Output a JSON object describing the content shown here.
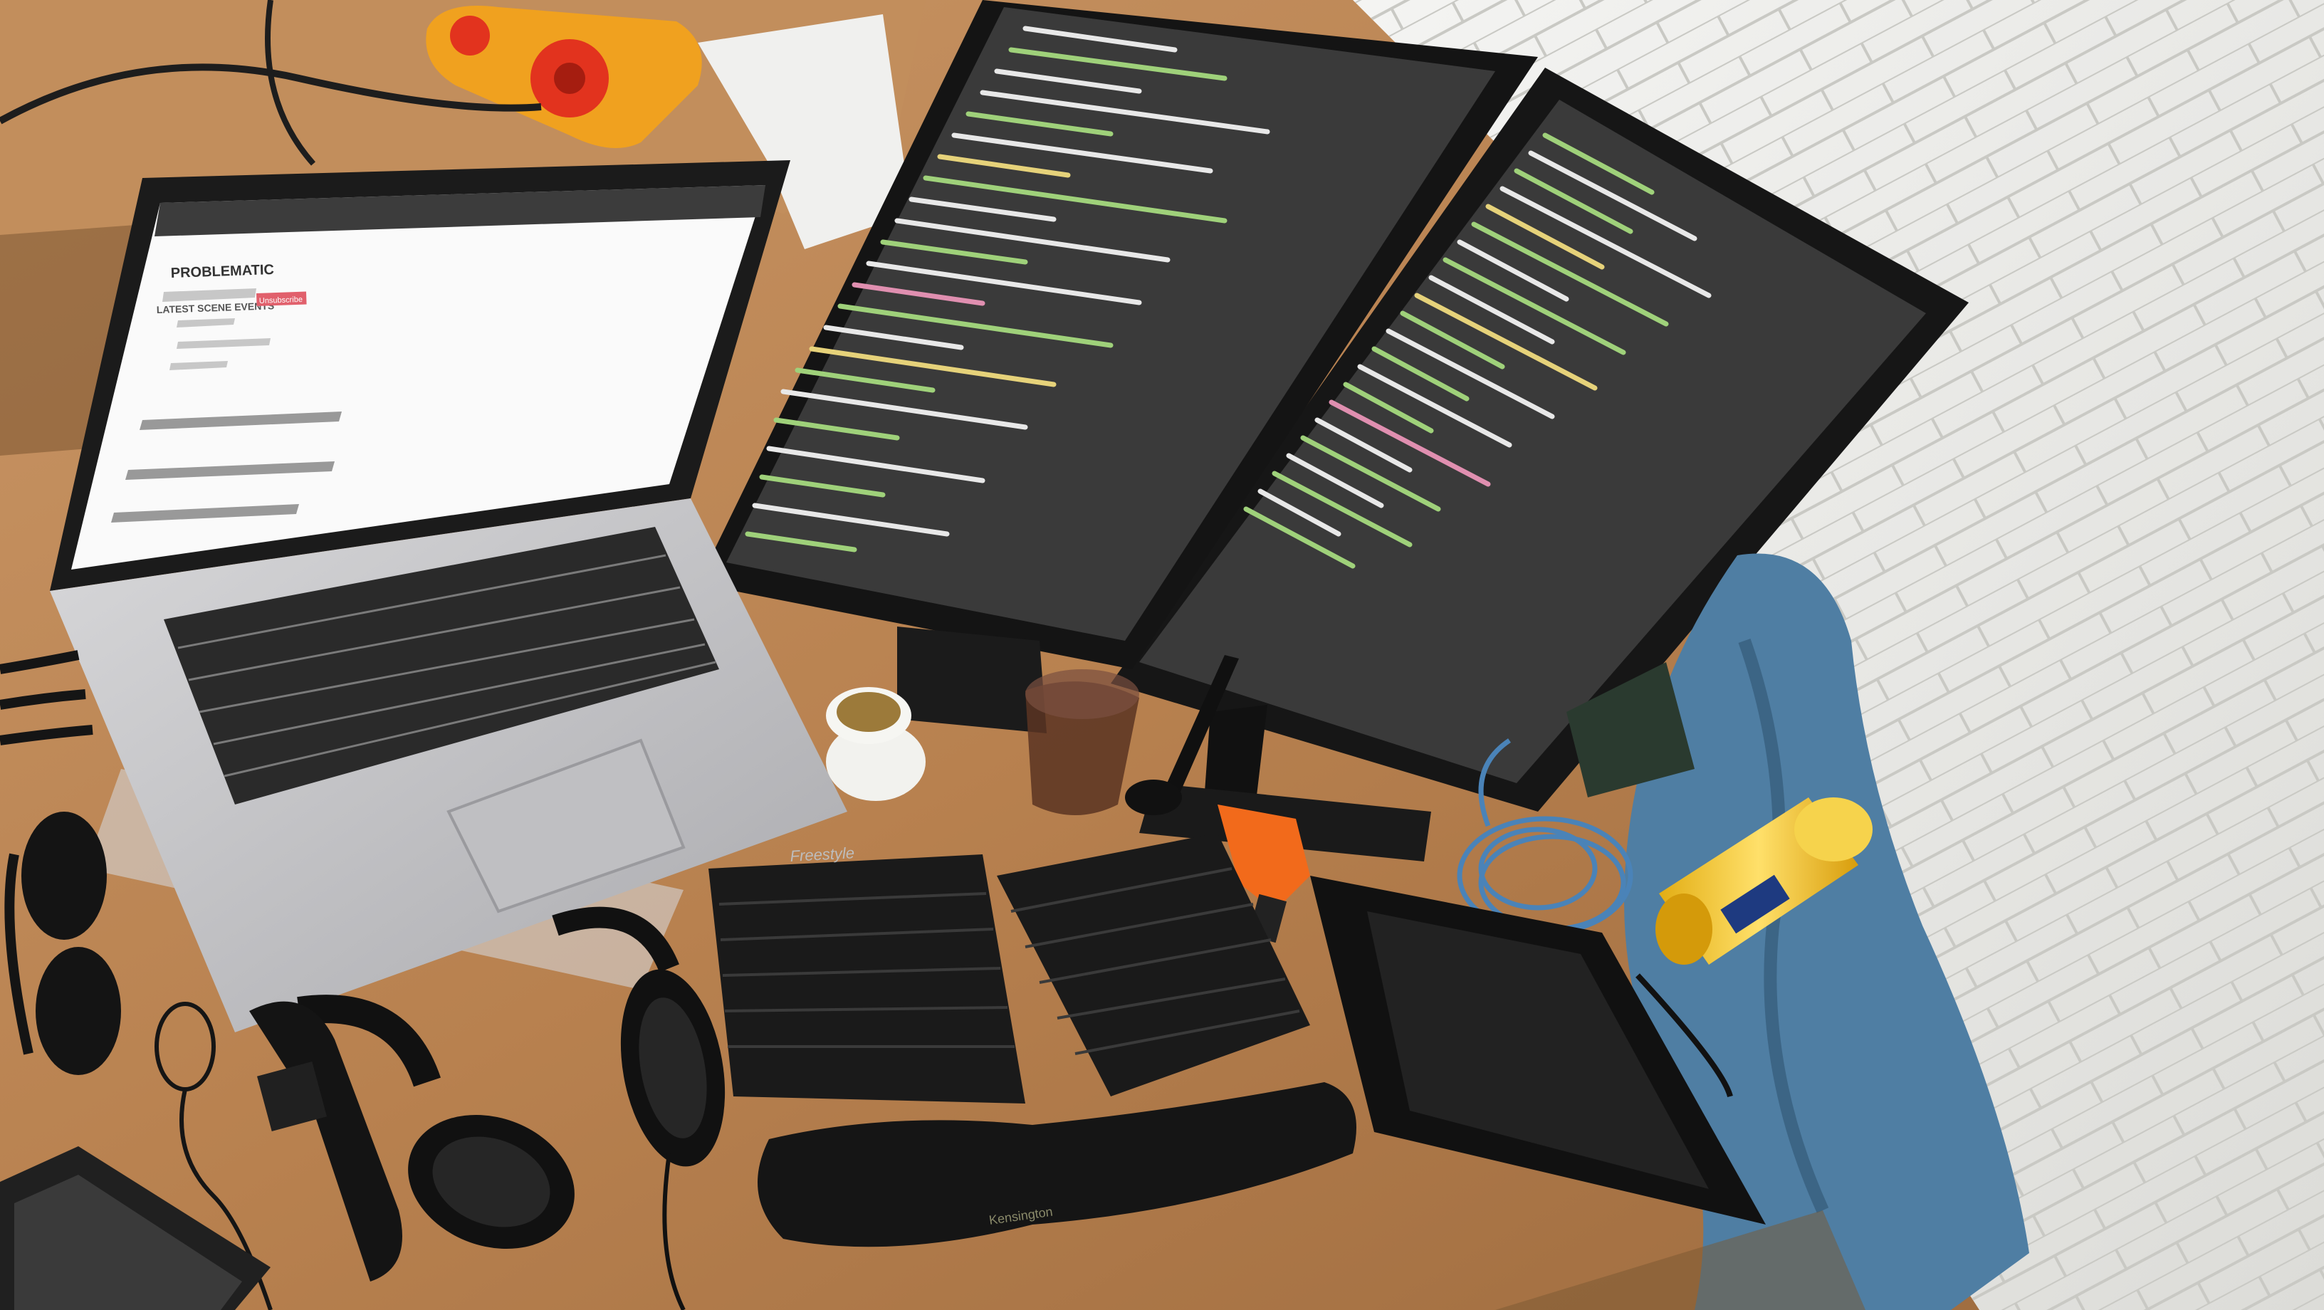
{
  "photo": {
    "laptop": {
      "brand_text": "PROBLEMATIC",
      "page_heading": "LATEST SCENE EVENTS",
      "tag": "Unsubscribe"
    },
    "keyboard": {
      "brand": "Freestyle"
    },
    "wrist_rest": {
      "brand": "Kensington"
    },
    "colors": {
      "desk": "#b9825a",
      "wall": "#ececea",
      "terminal_bg": "#3b3b3b",
      "code_green": "#9fd17a",
      "code_white": "#e8e8e8",
      "code_yellow": "#e6d27a",
      "code_pink": "#e08fb0",
      "blanket": "#4f7ea3",
      "yellow_can": "#f2c531"
    }
  }
}
